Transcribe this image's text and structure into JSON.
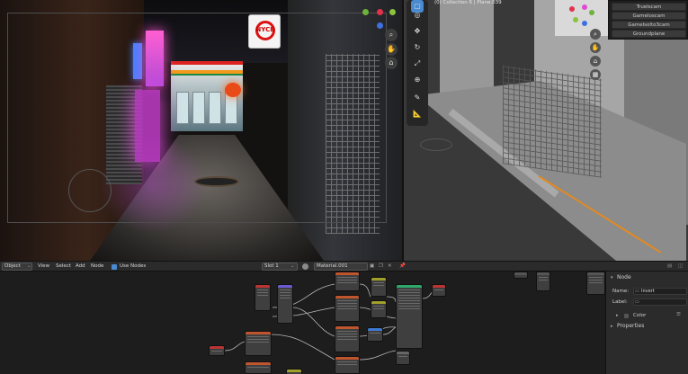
{
  "viewport3d": {
    "header_text": "(0) Collection 6 | Plane.039",
    "outliner_items": [
      "Truelscam",
      "Gameloscam",
      "Gamelsolto3cam",
      "Groundplane"
    ]
  },
  "render": {
    "sign_text": "NYCB"
  },
  "node_editor_header": {
    "editor_type": "Object",
    "menus": [
      "View",
      "Select",
      "Add",
      "Node"
    ],
    "use_nodes_label": "Use Nodes",
    "slot": "Slot 1",
    "material": "Material.001"
  },
  "sidebar": {
    "section_node": "Node",
    "name_label": "Name:",
    "name_value": "Invert",
    "label_label": "Label:",
    "label_value": "",
    "color_label": "Color",
    "section_properties": "Properties"
  },
  "colors": {
    "accent_blue": "#4a8ad0",
    "selection_orange": "#e38a1f",
    "neon_pink": "#ff5fd2"
  }
}
